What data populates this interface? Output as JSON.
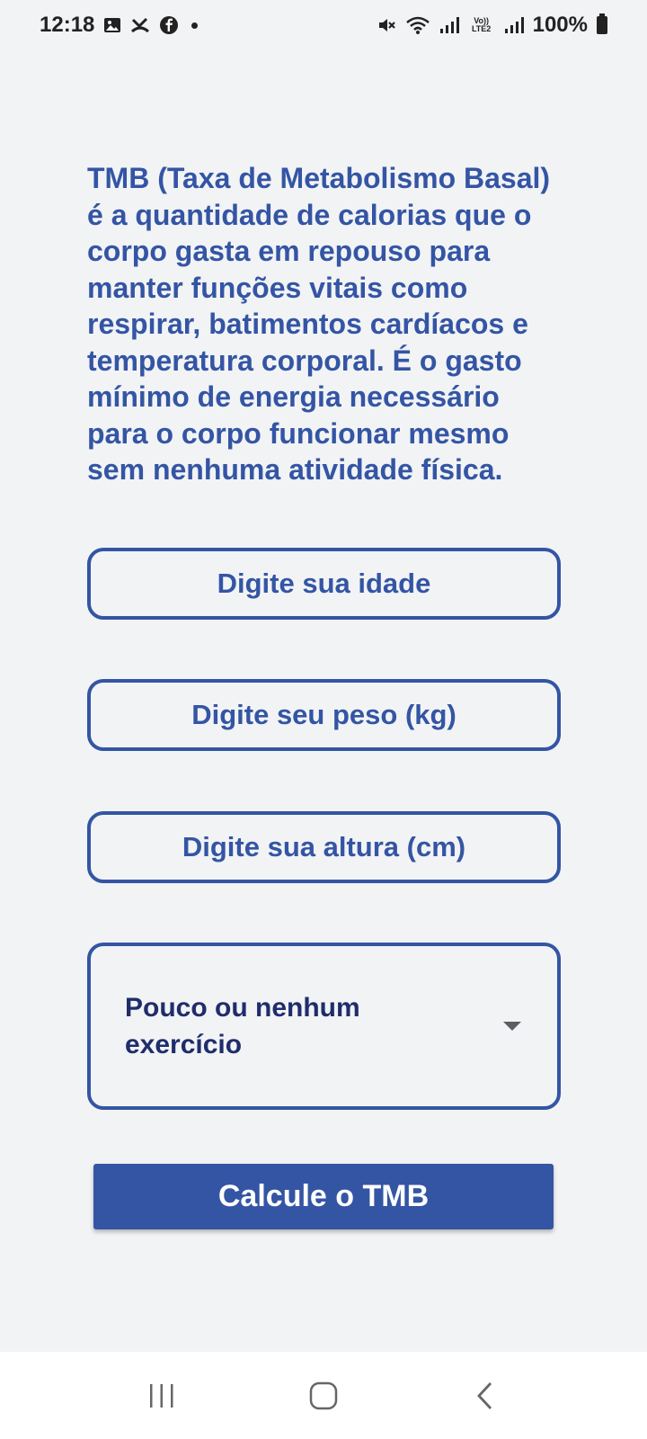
{
  "status_bar": {
    "time": "12:18",
    "battery": "100%",
    "icons_left": [
      "gallery-icon",
      "missed-call-icon",
      "facebook-icon",
      "notification-dot"
    ],
    "icons_right": [
      "mute-icon",
      "wifi-icon",
      "signal-icon",
      "volte-lte2-icon",
      "signal-icon-2",
      "battery-icon"
    ],
    "volte_label": "Vo)) LTE2"
  },
  "description": "TMB (Taxa de Metabolismo Basal) é a quantidade de calorias que o corpo gasta em repouso para manter funções vitais como respirar, batimentos cardíacos e temperatura corporal. É o gasto mínimo de energia necessário para o corpo funcionar mesmo sem nenhuma atividade física.",
  "form": {
    "age_placeholder": "Digite sua idade",
    "weight_placeholder": "Digite seu peso (kg)",
    "height_placeholder": "Digite sua altura (cm)",
    "activity_selected": "Pouco ou nenhum exercício",
    "submit_label": "Calcule o TMB"
  },
  "nav_bar": {
    "buttons": [
      "recent-apps-icon",
      "home-icon",
      "back-icon"
    ]
  },
  "colors": {
    "primary": "#3455a4",
    "background": "#f2f3f5",
    "dropdown_text": "#1f2d6b"
  }
}
